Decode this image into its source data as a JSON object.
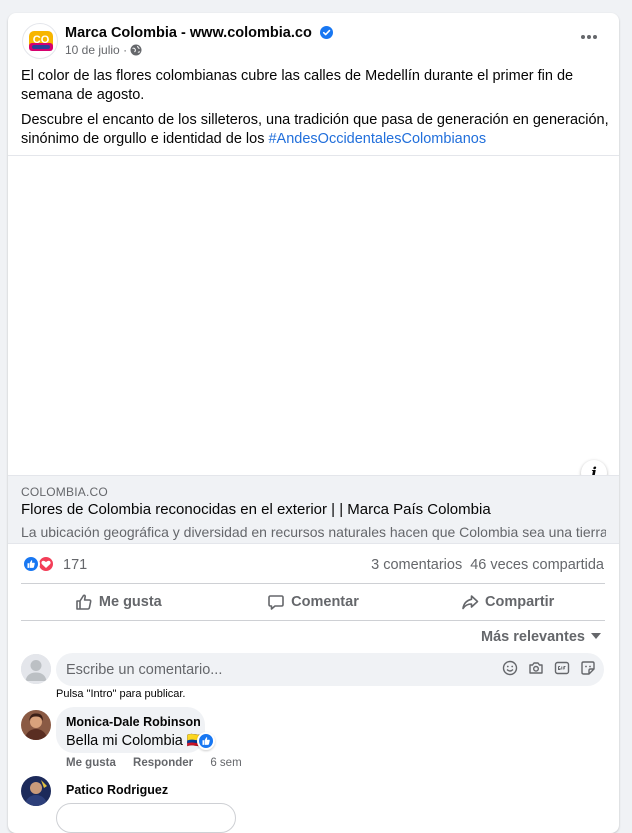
{
  "post": {
    "page_name": "Marca Colombia - www.colombia.co",
    "date": "10 de julio",
    "paragraph1": "El color de las flores colombianas cubre las calles de Medellín durante el primer fin de semana de agosto.",
    "paragraph2": "Descubre el encanto de los silleteros, una tradición que pasa de generación en generación, sinónimo de orgullo e identidad de los",
    "hashtag": "#AndesOccidentalesColombianos"
  },
  "logo": {
    "text": "CO"
  },
  "link": {
    "domain": "COLOMBIA.CO",
    "title": "Flores de Colombia reconocidas en el exterior | | Marca País Colombia",
    "description": "La ubicación geográfica y diversidad en recursos naturales hacen que Colombia sea una tierra ..."
  },
  "stats": {
    "reaction_count": "171",
    "comments": "3 comentarios",
    "shares": "46 veces compartida"
  },
  "actions": {
    "like": "Me gusta",
    "comment": "Comentar",
    "share": "Compartir"
  },
  "comments_section": {
    "sort_label": "Más relevantes",
    "input_placeholder": "Escribe un comentario...",
    "hint": "Pulsa \"Intro\" para publicar."
  },
  "comments": [
    {
      "author": "Monica-Dale Robinson",
      "text": "Bella mi Colombia 🇨🇴",
      "like": "Me gusta",
      "reply": "Responder",
      "time": "6 sem"
    },
    {
      "author": "Patico Rodriguez"
    }
  ],
  "colors": {
    "brand_blue": "#1877f2",
    "link_blue": "#216fdb",
    "love_red": "#f33e58",
    "secondary_text": "#65676b"
  }
}
